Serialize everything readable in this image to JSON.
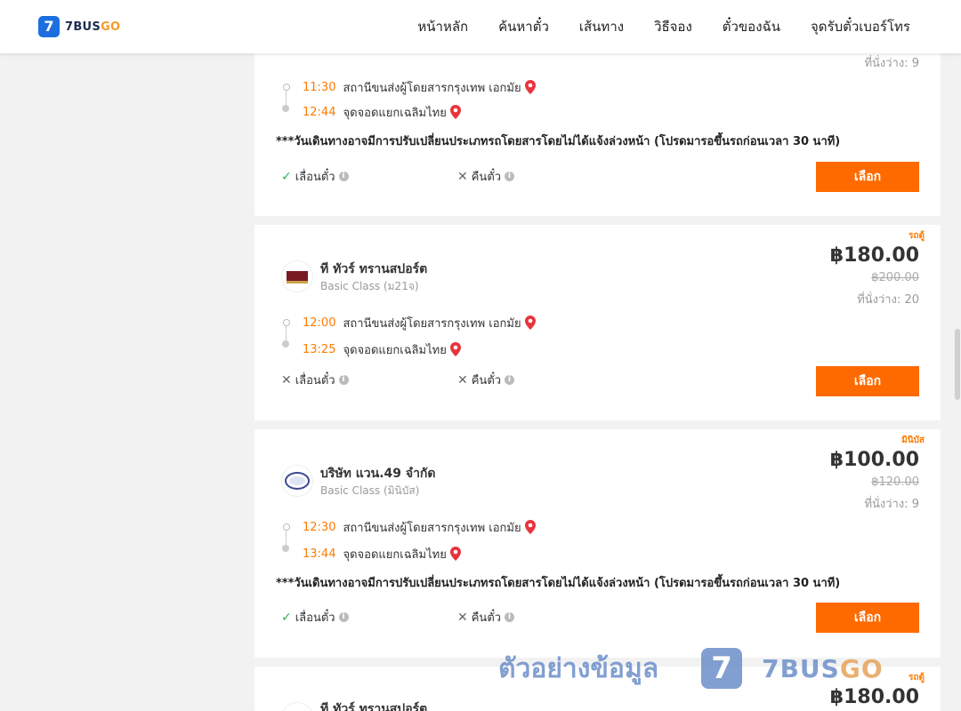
{
  "header": {
    "logo_badge": "7",
    "logo_part1": "7BUS",
    "logo_part2": "GO",
    "nav": [
      "หน้าหลัก",
      "ค้นหาตั๋ว",
      "เส้นทาง",
      "วิธีจอง",
      "ตั๋วของฉัน",
      "จุดรับตั๋วเบอร์โทร"
    ]
  },
  "colors": {
    "accent": "#ff6a00",
    "time": "#ff7a00",
    "brand_blue": "#1d6fe0",
    "check": "#2bb24c"
  },
  "common": {
    "notice": "***วันเดินทางอาจมีการปรับเปลี่ยนประเภทรถโดยสารโดยไม่ได้แจ้งล่วงหน้า (โปรดมารอขึ้นรถก่อนเวลา 30 นาที)",
    "change_label": "เลื่อนตั๋ว",
    "refund_label": "คืนตั๋ว",
    "select_label": "เลือก",
    "info_icon": "i",
    "check_icon": "✓",
    "cross_icon": "✕"
  },
  "cards": [
    {
      "seats": "ที่นั่งว่าง: 9",
      "depart_time": "11:30",
      "depart_place": "สถานีขนส่งผู้โดยสารกรุงเทพ เอกมัย",
      "arrive_time": "12:44",
      "arrive_place": "จุดจอดแยกเฉลิมไทย"
    },
    {
      "tag": "รถตู้",
      "operator": "ที ทัวร์ ทรานสปอร์ต",
      "class": "Basic Class (ม21จ)",
      "price": "฿180.00",
      "old_price": "฿200.00",
      "seats": "ที่นั่งว่าง: 20",
      "depart_time": "12:00",
      "depart_place": "สถานีขนส่งผู้โดยสารกรุงเทพ เอกมัย",
      "arrive_time": "13:25",
      "arrive_place": "จุดจอดแยกเฉลิมไทย"
    },
    {
      "tag": "มินิบัส",
      "operator": "บริษัท แวน.49 จำกัด",
      "class": "Basic Class (มินิบัส)",
      "price": "฿100.00",
      "old_price": "฿120.00",
      "seats": "ที่นั่งว่าง: 9",
      "depart_time": "12:30",
      "depart_place": "สถานีขนส่งผู้โดยสารกรุงเทพ เอกมัย",
      "arrive_time": "13:44",
      "arrive_place": "จุดจอดแยกเฉลิมไทย"
    },
    {
      "tag": "รถตู้",
      "operator": "ที ทัวร์ ทรานสปอร์ต",
      "price": "฿180.00"
    }
  ],
  "watermark": {
    "text": "ตัวอย่างข้อมูล",
    "badge": "7",
    "logo_part1": "7BUS",
    "logo_part2": "GO"
  }
}
